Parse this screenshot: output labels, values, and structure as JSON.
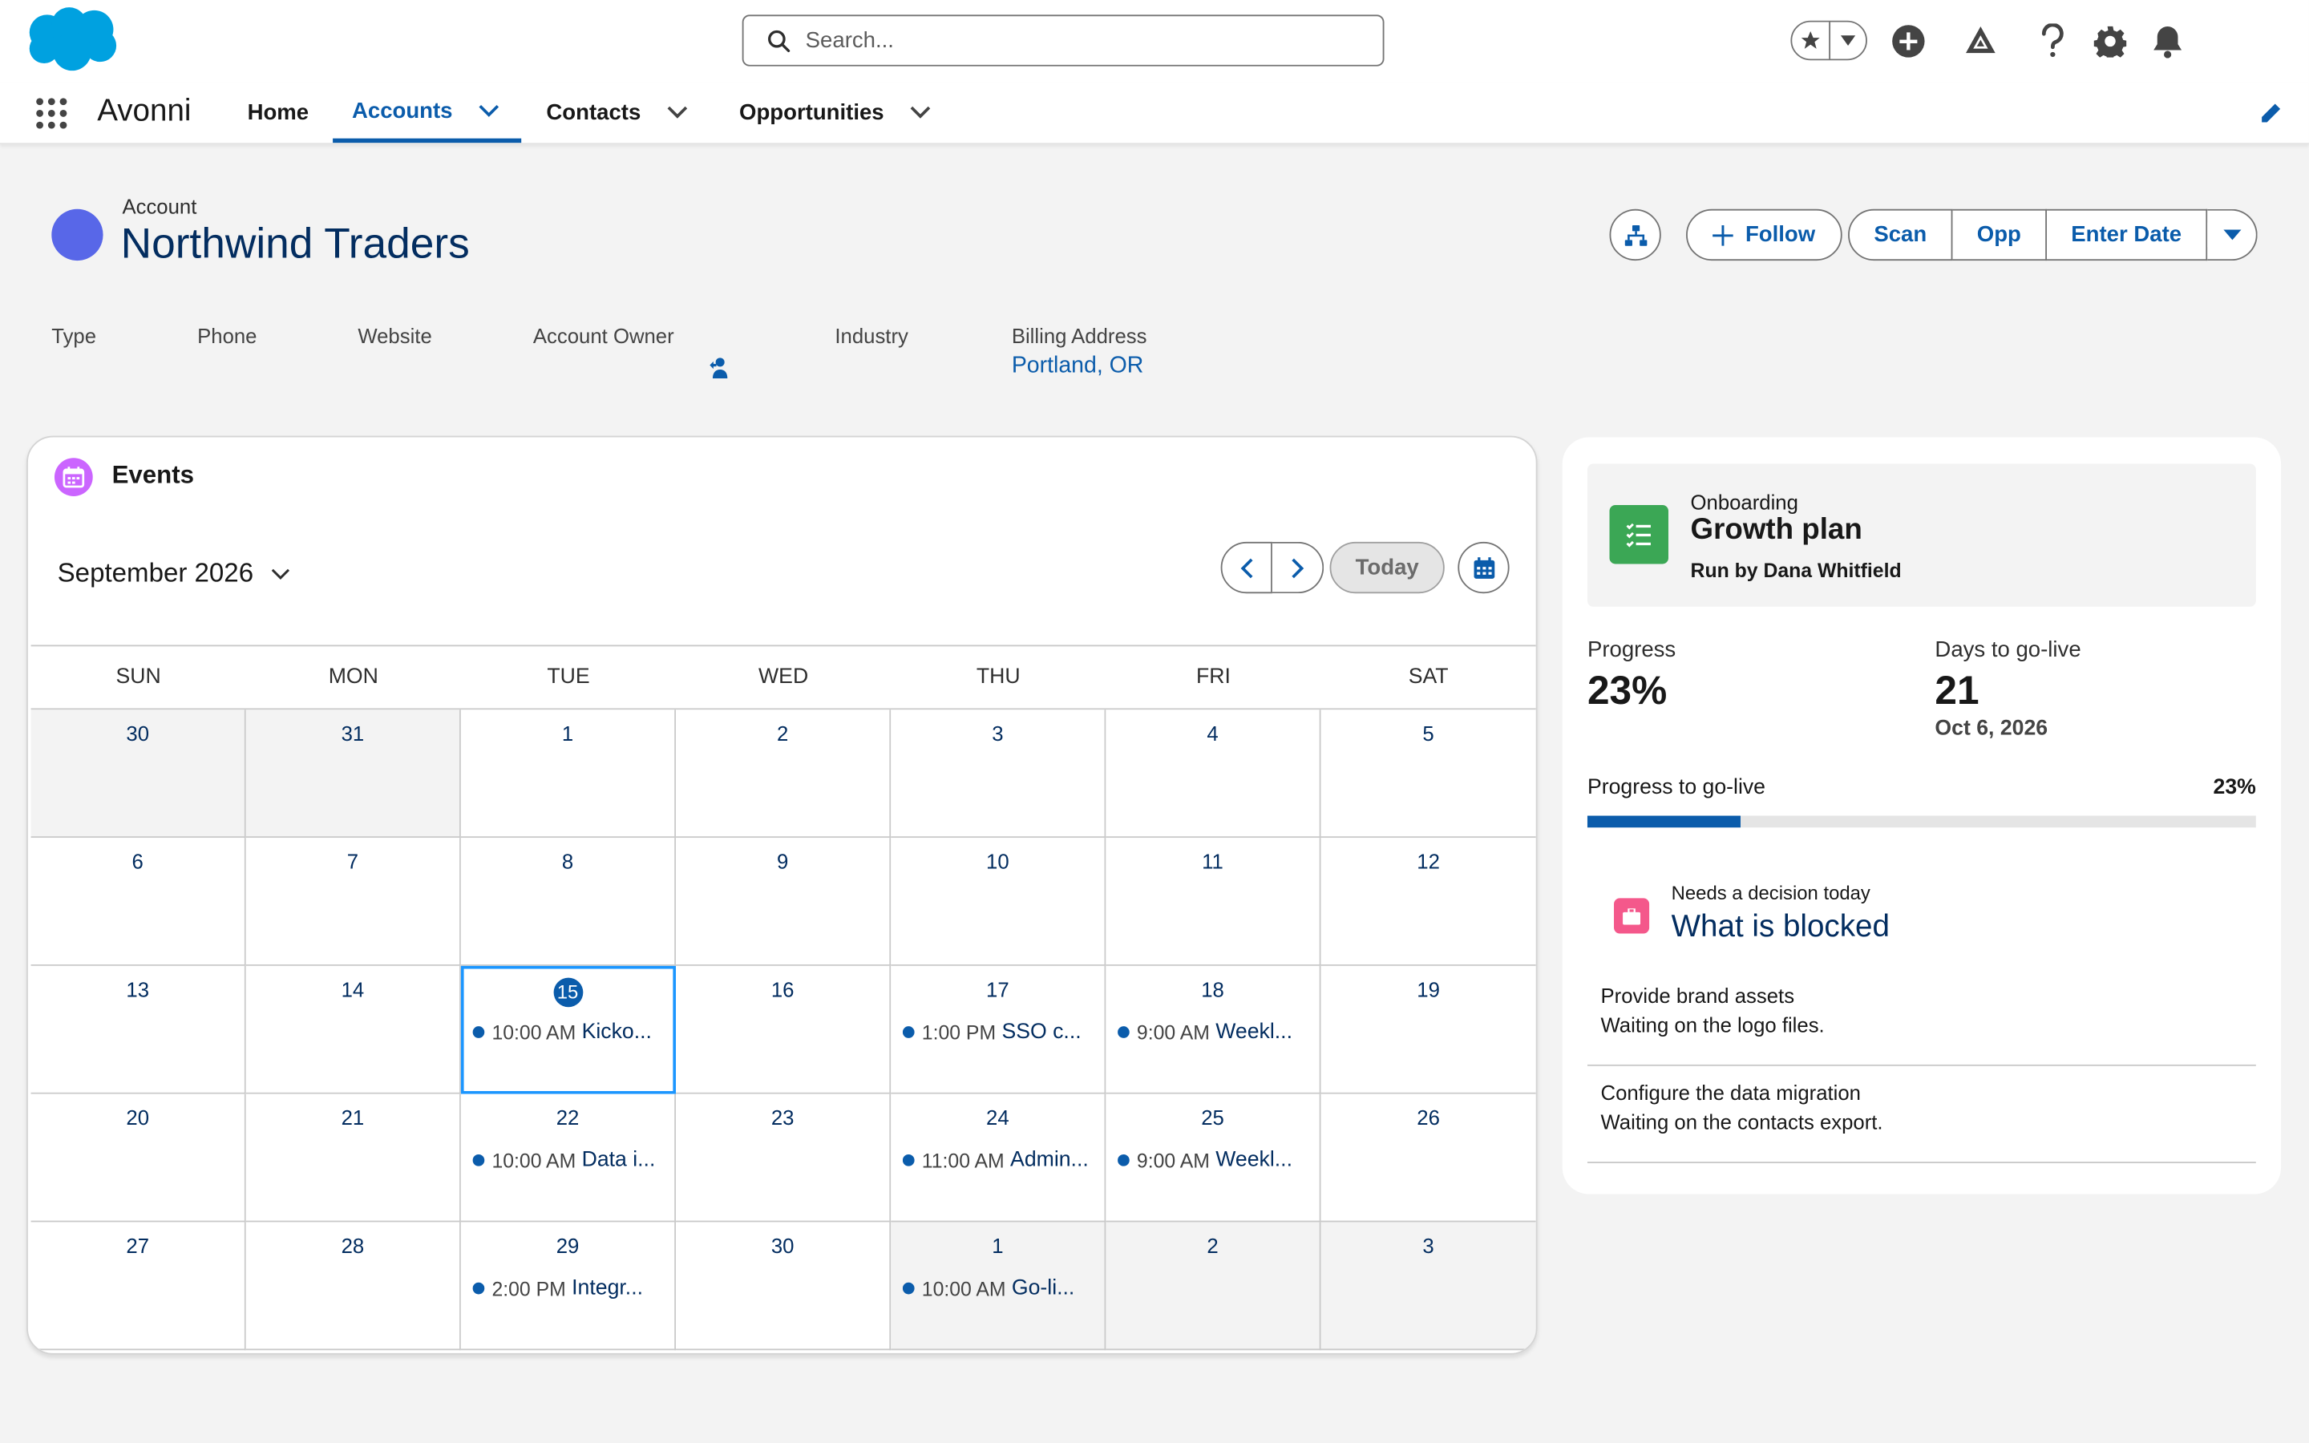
{
  "header": {
    "search_placeholder": "Search...",
    "brand_color": "#00a1e0"
  },
  "nav": {
    "app_name": "Avonni",
    "items": [
      {
        "label": "Home",
        "active": false
      },
      {
        "label": "Accounts",
        "active": true
      },
      {
        "label": "Contacts",
        "active": false
      },
      {
        "label": "Opportunities",
        "active": false
      }
    ]
  },
  "record": {
    "type": "Account",
    "title": "Northwind Traders",
    "actions": {
      "follow": "Follow",
      "scan": "Scan",
      "opp": "Opp",
      "enter_date": "Enter Date"
    },
    "fields": {
      "type_label": "Type",
      "phone_label": "Phone",
      "website_label": "Website",
      "owner_label": "Account Owner",
      "industry_label": "Industry",
      "billing_label": "Billing Address",
      "billing_value": "Portland, OR"
    }
  },
  "events": {
    "title": "Events",
    "month": "September 2026",
    "today_label": "Today",
    "weekdays": [
      "SUN",
      "MON",
      "TUE",
      "WED",
      "THU",
      "FRI",
      "SAT"
    ],
    "weeks": [
      [
        {
          "day": "30",
          "outside": true
        },
        {
          "day": "31",
          "outside": true
        },
        {
          "day": "1"
        },
        {
          "day": "2"
        },
        {
          "day": "3"
        },
        {
          "day": "4"
        },
        {
          "day": "5"
        }
      ],
      [
        {
          "day": "6"
        },
        {
          "day": "7"
        },
        {
          "day": "8"
        },
        {
          "day": "9"
        },
        {
          "day": "10"
        },
        {
          "day": "11"
        },
        {
          "day": "12"
        }
      ],
      [
        {
          "day": "13"
        },
        {
          "day": "14"
        },
        {
          "day": "15",
          "today": true,
          "event": {
            "time": "10:00 AM",
            "title": "Kicko..."
          }
        },
        {
          "day": "16"
        },
        {
          "day": "17",
          "event": {
            "time": "1:00 PM",
            "title": "SSO c..."
          }
        },
        {
          "day": "18",
          "event": {
            "time": "9:00 AM",
            "title": "Weekl..."
          }
        },
        {
          "day": "19"
        }
      ],
      [
        {
          "day": "20"
        },
        {
          "day": "21"
        },
        {
          "day": "22",
          "event": {
            "time": "10:00 AM",
            "title": "Data i..."
          }
        },
        {
          "day": "23"
        },
        {
          "day": "24",
          "event": {
            "time": "11:00 AM",
            "title": "Admin..."
          }
        },
        {
          "day": "25",
          "event": {
            "time": "9:00 AM",
            "title": "Weekl..."
          }
        },
        {
          "day": "26"
        }
      ],
      [
        {
          "day": "27"
        },
        {
          "day": "28"
        },
        {
          "day": "29",
          "event": {
            "time": "2:00 PM",
            "title": "Integr..."
          }
        },
        {
          "day": "30"
        },
        {
          "day": "1",
          "outside": true,
          "event": {
            "time": "10:00 AM",
            "title": "Go-li..."
          }
        },
        {
          "day": "2",
          "outside": true
        },
        {
          "day": "3",
          "outside": true
        }
      ]
    ]
  },
  "plan": {
    "eyebrow": "Onboarding",
    "title": "Growth plan",
    "subtitle": "Run by Dana Whitfield",
    "progress_label": "Progress",
    "progress_value": "23%",
    "days_label": "Days to go-live",
    "days_value": "21",
    "golive_date": "Oct 6, 2026",
    "bar_label": "Progress to go-live",
    "bar_percent": "23%",
    "bar_fraction": 0.23,
    "blocked": {
      "eyebrow": "Needs a decision today",
      "title": "What is blocked",
      "items": [
        {
          "title": "Provide brand assets",
          "desc": "Waiting on the logo files."
        },
        {
          "title": "Configure the data migration",
          "desc": "Waiting on the contacts export."
        }
      ]
    }
  }
}
